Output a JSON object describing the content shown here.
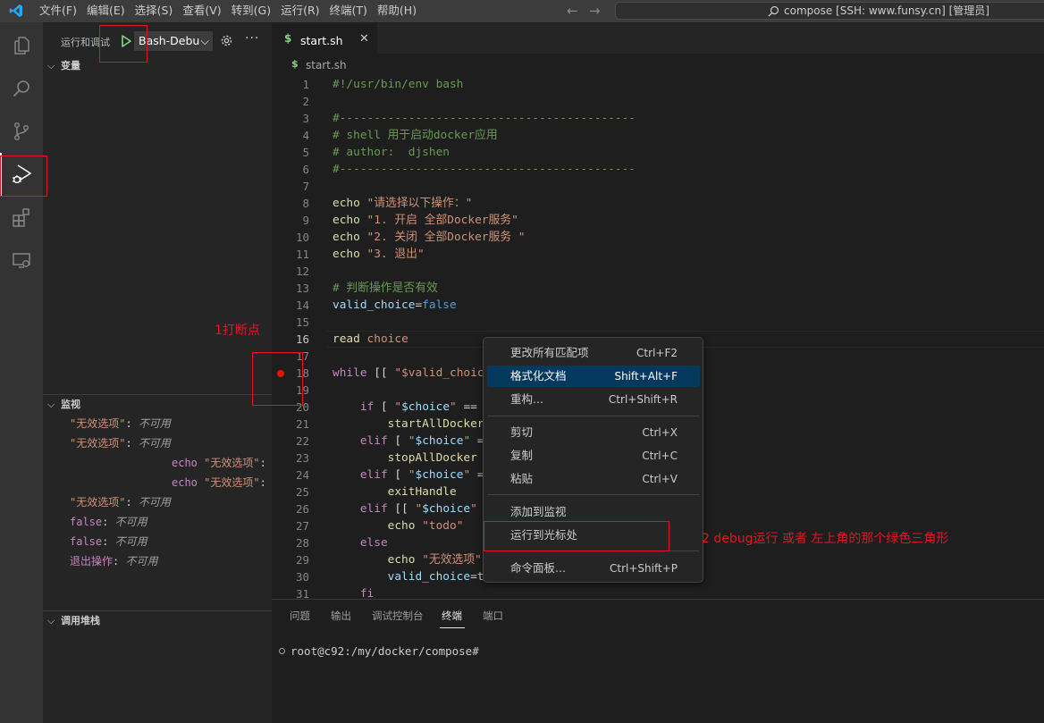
{
  "titlebar": {
    "menu": [
      "文件(F)",
      "编辑(E)",
      "选择(S)",
      "查看(V)",
      "转到(G)",
      "运行(R)",
      "终端(T)",
      "帮助(H)"
    ],
    "command_center": "compose [SSH: www.funsy.cn] [管理员]"
  },
  "activity_bar": {
    "items": [
      "explorer-icon",
      "search-icon",
      "source-control-icon",
      "run-debug-icon",
      "extensions-icon",
      "remote-explorer-icon"
    ],
    "active": "run-debug-icon"
  },
  "sidebar": {
    "title": "运行和调试",
    "config_name": "Bash-Debug",
    "variables_header": "变量",
    "watch_header": "监视",
    "callstack_header": "调用堆栈",
    "watch_items": [
      {
        "prefix": "",
        "name": "\"无效选项\"",
        "value": "不可用"
      },
      {
        "prefix": "",
        "name": "\"无效选项\"",
        "value": "不可用"
      },
      {
        "prefix": "echo ",
        "name": "\"无效选项\"",
        "value": ""
      },
      {
        "prefix": "echo ",
        "name": "\"无效选项\"",
        "value": ""
      },
      {
        "prefix": "",
        "name": "\"无效选项\"",
        "value": "不可用"
      },
      {
        "prefix": "",
        "name": "false",
        "value": "不可用"
      },
      {
        "prefix": "",
        "name": "false",
        "value": "不可用"
      },
      {
        "prefix": "",
        "name": "退出操作",
        "value": "不可用"
      }
    ]
  },
  "editor": {
    "tab_label": "start.sh",
    "breadcrumb": "start.sh",
    "current_line": 16,
    "breakpoint_line": 18,
    "lines": [
      {
        "n": "1",
        "t": [
          [
            "com",
            "#!/usr/bin/env bash"
          ]
        ]
      },
      {
        "n": "2",
        "t": []
      },
      {
        "n": "3",
        "t": [
          [
            "com",
            "#-------------------------------------------"
          ]
        ]
      },
      {
        "n": "4",
        "t": [
          [
            "com",
            "# shell 用于启动docker应用"
          ]
        ]
      },
      {
        "n": "5",
        "t": [
          [
            "com",
            "# author:  djshen"
          ]
        ]
      },
      {
        "n": "6",
        "t": [
          [
            "com",
            "#-------------------------------------------"
          ]
        ]
      },
      {
        "n": "7",
        "t": []
      },
      {
        "n": "8",
        "t": [
          [
            "fn",
            "echo"
          ],
          [
            "pl",
            " "
          ],
          [
            "str",
            "\"请选择以下操作：\""
          ]
        ]
      },
      {
        "n": "9",
        "t": [
          [
            "fn",
            "echo"
          ],
          [
            "pl",
            " "
          ],
          [
            "str",
            "\"1. 开启 全部Docker服务\""
          ]
        ]
      },
      {
        "n": "10",
        "t": [
          [
            "fn",
            "echo"
          ],
          [
            "pl",
            " "
          ],
          [
            "str",
            "\"2. 关闭 全部Docker服务 \""
          ]
        ]
      },
      {
        "n": "11",
        "t": [
          [
            "fn",
            "echo"
          ],
          [
            "pl",
            " "
          ],
          [
            "str",
            "\"3. 退出\""
          ]
        ]
      },
      {
        "n": "12",
        "t": []
      },
      {
        "n": "13",
        "t": [
          [
            "com",
            "# 判断操作是否有效"
          ]
        ]
      },
      {
        "n": "14",
        "t": [
          [
            "var",
            "valid_choice"
          ],
          [
            "pl",
            "="
          ],
          [
            "kw",
            "false"
          ]
        ]
      },
      {
        "n": "15",
        "t": []
      },
      {
        "n": "16",
        "t": [
          [
            "fn",
            "read"
          ],
          [
            "pl",
            " "
          ],
          [
            "str",
            "choice"
          ]
        ]
      },
      {
        "n": "17",
        "t": []
      },
      {
        "n": "18",
        "t": [
          [
            "ctl",
            "while"
          ],
          [
            "pl",
            " [[ "
          ],
          [
            "str",
            "\"$valid_choic"
          ]
        ]
      },
      {
        "n": "19",
        "t": []
      },
      {
        "n": "20",
        "t": [
          [
            "pl",
            "    "
          ],
          [
            "ctl",
            "if"
          ],
          [
            "pl",
            " [ "
          ],
          [
            "str",
            "\""
          ],
          [
            "var",
            "$choice"
          ],
          [
            "str",
            "\""
          ],
          [
            "pl",
            " =="
          ]
        ]
      },
      {
        "n": "21",
        "t": [
          [
            "pl",
            "        "
          ],
          [
            "fn",
            "startAllDocker"
          ]
        ]
      },
      {
        "n": "22",
        "t": [
          [
            "pl",
            "    "
          ],
          [
            "ctl",
            "elif"
          ],
          [
            "pl",
            " [ "
          ],
          [
            "str",
            "\""
          ],
          [
            "var",
            "$choice"
          ],
          [
            "str",
            "\""
          ],
          [
            "pl",
            " ="
          ]
        ]
      },
      {
        "n": "23",
        "t": [
          [
            "pl",
            "        "
          ],
          [
            "fn",
            "stopAllDocker"
          ]
        ]
      },
      {
        "n": "24",
        "t": [
          [
            "pl",
            "    "
          ],
          [
            "ctl",
            "elif"
          ],
          [
            "pl",
            " [ "
          ],
          [
            "str",
            "\""
          ],
          [
            "var",
            "$choice"
          ],
          [
            "str",
            "\""
          ],
          [
            "pl",
            " ="
          ]
        ]
      },
      {
        "n": "25",
        "t": [
          [
            "pl",
            "        "
          ],
          [
            "fn",
            "exitHandle"
          ]
        ]
      },
      {
        "n": "26",
        "t": [
          [
            "pl",
            "    "
          ],
          [
            "ctl",
            "elif"
          ],
          [
            "pl",
            " [[ "
          ],
          [
            "str",
            "\""
          ],
          [
            "var",
            "$choice"
          ],
          [
            "str",
            "\""
          ]
        ]
      },
      {
        "n": "27",
        "t": [
          [
            "pl",
            "        "
          ],
          [
            "fn",
            "echo"
          ],
          [
            "pl",
            " "
          ],
          [
            "str",
            "\"todo\""
          ]
        ]
      },
      {
        "n": "28",
        "t": [
          [
            "pl",
            "    "
          ],
          [
            "ctl",
            "else"
          ]
        ]
      },
      {
        "n": "29",
        "t": [
          [
            "pl",
            "        "
          ],
          [
            "fn",
            "echo"
          ],
          [
            "pl",
            " "
          ],
          [
            "str",
            "\"无效选项\""
          ]
        ]
      },
      {
        "n": "30",
        "t": [
          [
            "pl",
            "        "
          ],
          [
            "var",
            "valid_choice"
          ],
          [
            "pl",
            "=t"
          ]
        ]
      },
      {
        "n": "31",
        "t": [
          [
            "pl",
            "    "
          ],
          [
            "ctl",
            "fi"
          ]
        ]
      }
    ]
  },
  "context_menu": {
    "items": [
      {
        "label": "更改所有匹配项",
        "key": "Ctrl+F2"
      },
      {
        "label": "格式化文档",
        "key": "Shift+Alt+F",
        "selected": true
      },
      {
        "label": "重构...",
        "key": "Ctrl+Shift+R"
      },
      {
        "label": "剪切",
        "key": "Ctrl+X"
      },
      {
        "label": "复制",
        "key": "Ctrl+C"
      },
      {
        "label": "粘贴",
        "key": "Ctrl+V"
      },
      {
        "label": "添加到监视",
        "key": ""
      },
      {
        "label": "运行到光标处",
        "key": ""
      },
      {
        "label": "命令面板...",
        "key": "Ctrl+Shift+P"
      }
    ]
  },
  "panel": {
    "tabs": [
      "问题",
      "输出",
      "调试控制台",
      "终端",
      "端口"
    ],
    "active_tab": "终端",
    "terminal_prompt": "root@c92:/my/docker/compose#"
  },
  "annotations": {
    "breakpoint_note": "1打断点",
    "run_note": "2 debug运行 或者 左上角的那个绿色三角形"
  },
  "colors": {
    "accent": "#007acc",
    "annotation_red": "#e81123",
    "run_green": "#89d185",
    "menu_selection": "#04395e"
  }
}
